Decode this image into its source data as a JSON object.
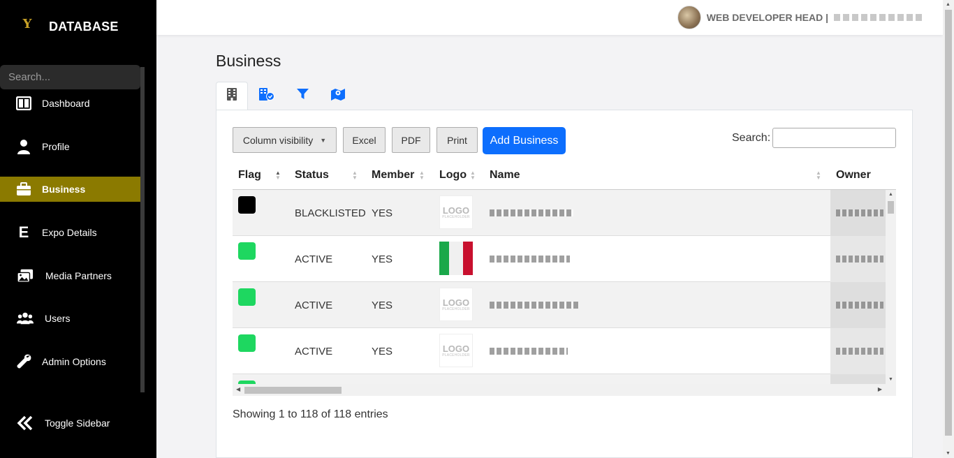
{
  "sidebar": {
    "brand_logo": "Y",
    "brand_title": "DATABASE",
    "search_placeholder": "Search...",
    "items": [
      {
        "label": "Dashboard",
        "icon": "dashboard-icon"
      },
      {
        "label": "Profile",
        "icon": "user-icon"
      },
      {
        "label": "Business",
        "icon": "briefcase-icon",
        "active": true
      },
      {
        "label": "Expo Details",
        "icon": "letter-e-icon"
      },
      {
        "label": "Media Partners",
        "icon": "images-icon"
      },
      {
        "label": "Users",
        "icon": "users-icon"
      },
      {
        "label": "Admin Options",
        "icon": "wrench-icon"
      }
    ],
    "toggle_label": "Toggle Sidebar",
    "active_color": "#8b7a00"
  },
  "topbar": {
    "user_role": "WEB DEVELOPER HEAD |"
  },
  "page": {
    "title": "Business",
    "tabs": [
      {
        "icon": "building-icon",
        "active": true
      },
      {
        "icon": "building-check-icon"
      },
      {
        "icon": "filter-icon"
      },
      {
        "icon": "map-location-icon"
      }
    ]
  },
  "toolbar": {
    "column_visibility": "Column visibility",
    "excel": "Excel",
    "pdf": "PDF",
    "print": "Print",
    "add_business": "Add Business",
    "search_label": "Search:",
    "primary_color": "#0d6efd"
  },
  "table": {
    "headers": [
      "Flag",
      "Status",
      "Member",
      "Logo",
      "Name",
      "Owner"
    ],
    "rows": [
      {
        "flag_color": "#000000",
        "status": "BLACKLISTED",
        "member": "YES",
        "logo": "placeholder",
        "logo_text": "LOGO",
        "logo_sub": "PLACEHOLDER"
      },
      {
        "flag_color": "#1ed760",
        "status": "ACTIVE",
        "member": "YES",
        "logo": "flag-image"
      },
      {
        "flag_color": "#1ed760",
        "status": "ACTIVE",
        "member": "YES",
        "logo": "placeholder",
        "logo_text": "LOGO",
        "logo_sub": "PLACEHOLDER"
      },
      {
        "flag_color": "#1ed760",
        "status": "ACTIVE",
        "member": "YES",
        "logo": "placeholder",
        "logo_text": "LOGO",
        "logo_sub": "PLACEHOLDER"
      }
    ],
    "info": "Showing 1 to 118 of 118 entries"
  }
}
